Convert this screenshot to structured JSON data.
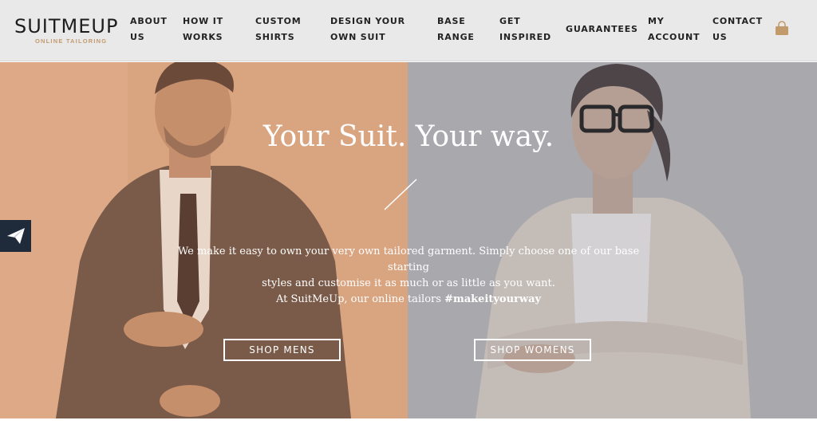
{
  "brand": {
    "name": "SUITMEUP",
    "tagline": "ONLINE TAILORING",
    "accent": "#c29a6c"
  },
  "nav": {
    "items": [
      {
        "line1": "ABOUT",
        "line2": "US"
      },
      {
        "line1": "HOW IT",
        "line2": "WORKS"
      },
      {
        "line1": "CUSTOM",
        "line2": "SHIRTS"
      },
      {
        "line1": "DESIGN YOUR",
        "line2": "OWN SUIT"
      },
      {
        "line1": "BASE",
        "line2": "RANGE"
      },
      {
        "line1": "GET",
        "line2": "INSPIRED"
      },
      {
        "line1": "GUARANTEES",
        "line2": ""
      },
      {
        "line1": "MY",
        "line2": "ACCOUNT"
      },
      {
        "line1": "CONTACT",
        "line2": "US"
      }
    ],
    "cart_icon": "shopping-bag-icon"
  },
  "hero": {
    "title": "Your Suit. Your way.",
    "body_line1": "We make it easy to own your very own tailored garment.   Simply choose one of our base starting",
    "body_line2": "styles and customise it as much or as little as you want.",
    "body_line3_prefix": "At SuitMeUp, our online tailors ",
    "body_line3_tag": "#makeityourway",
    "left_color": "#d9a480",
    "right_color": "#a9a8ad"
  },
  "buttons": {
    "shop_mens": "SHOP MENS",
    "shop_womens": "SHOP WOMENS"
  },
  "share": {
    "icon": "paper-plane-icon",
    "color": "#1f2a3b"
  }
}
